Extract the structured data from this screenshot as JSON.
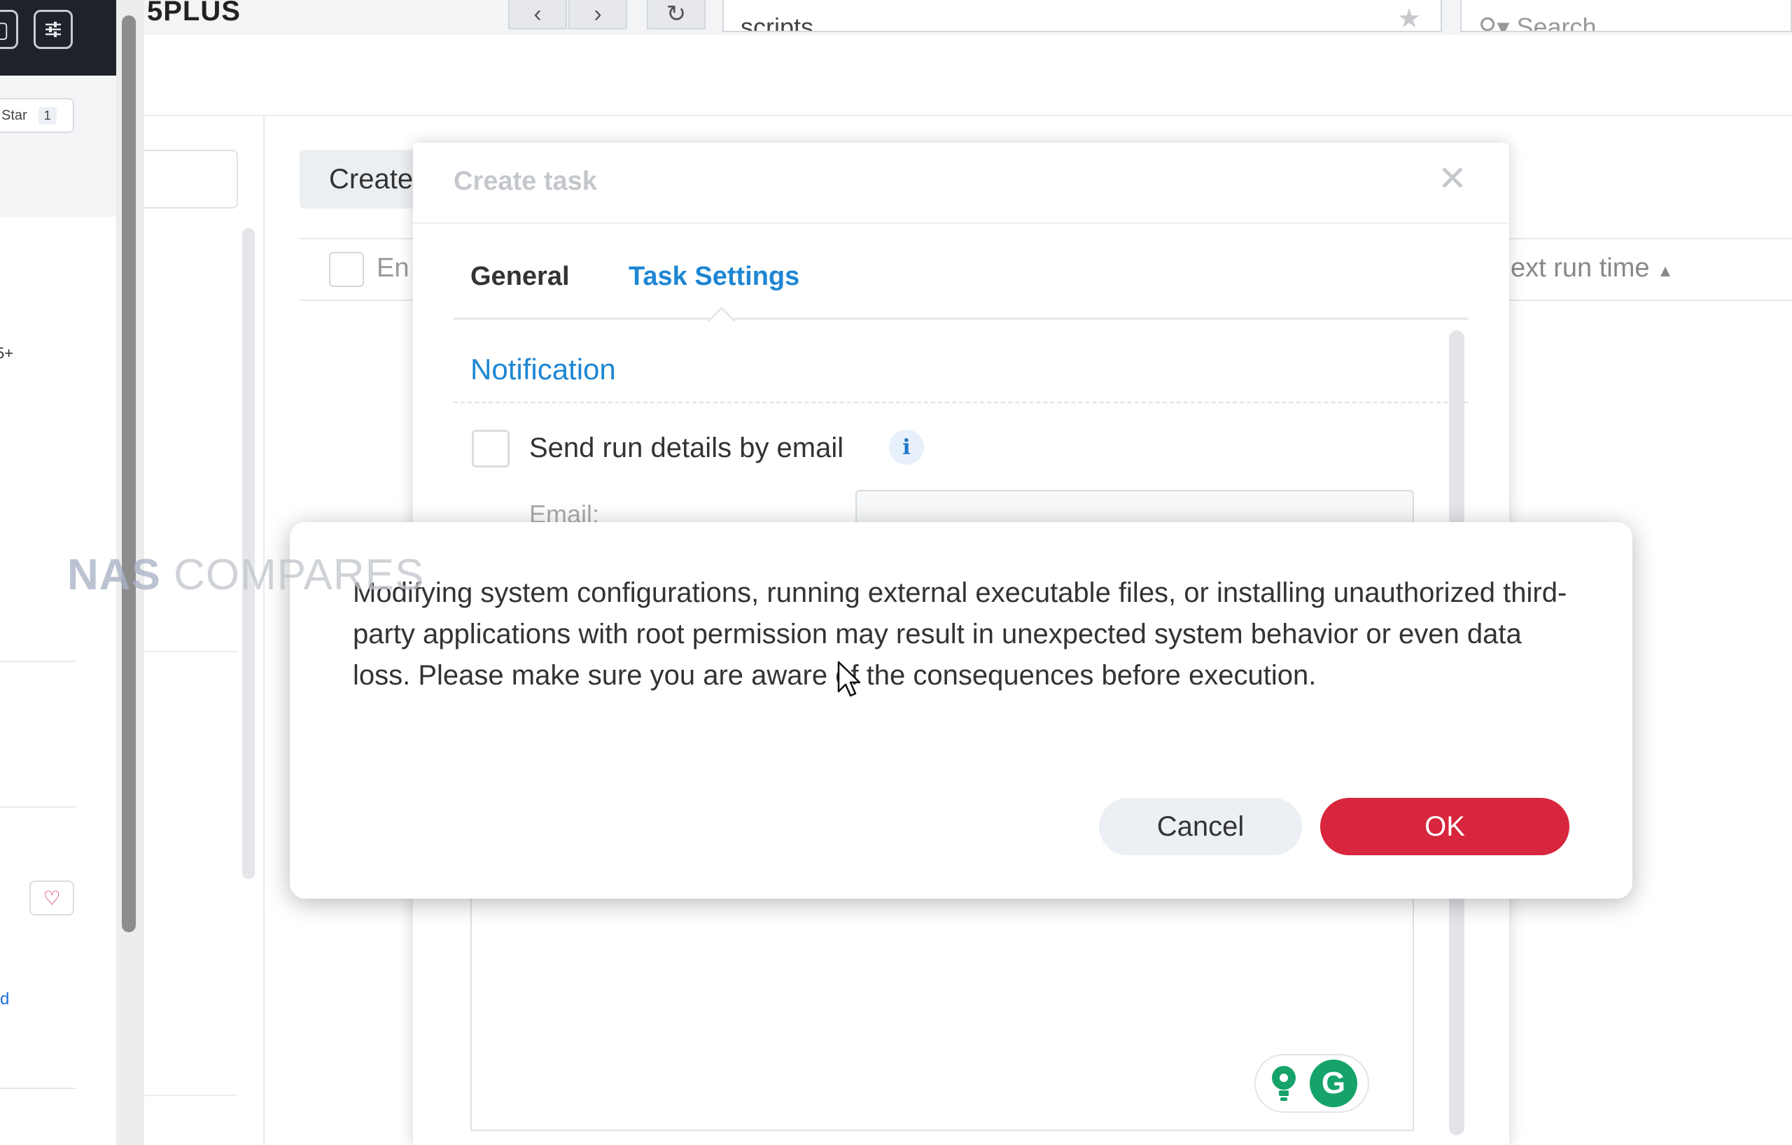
{
  "browser": {
    "brand": "5PLUS",
    "url": "scripts",
    "search_placeholder": "Search"
  },
  "sidebar": {
    "star_label": "Star",
    "star_count": "1",
    "model_text": "5+",
    "link_text": "d"
  },
  "background_app": {
    "create_button": "Create",
    "column_enabled": "En",
    "column_next_run": "ext run time"
  },
  "create_task_dialog": {
    "title": "Create task",
    "tabs": [
      "General",
      "Task Settings"
    ],
    "active_tab": "Task Settings",
    "section_title": "Notification",
    "send_email_label": "Send run details by email",
    "email_label": "Email:"
  },
  "warning_modal": {
    "message": "Modifying system configurations, running external executable files, or installing unauthorized third-party applications with root permission may result in unexpected system behavior or even data loss. Please make sure you are aware of the consequences before execution.",
    "cancel_label": "Cancel",
    "ok_label": "OK"
  },
  "watermark": {
    "part1": "NAS",
    "part2": "COMPARES"
  },
  "colors": {
    "accent_blue": "#1e86d3",
    "ok_red": "#d7263d",
    "grammarly_green": "#15a36a"
  }
}
